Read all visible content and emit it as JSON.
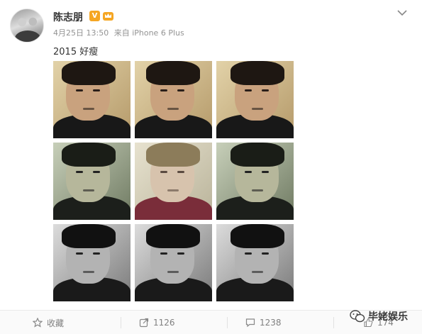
{
  "post": {
    "author": "陈志朋",
    "verified_badge": "V",
    "date": "4月25日 13:50",
    "via": "来自 iPhone 6 Plus",
    "text": "2015 好瘦"
  },
  "photos": [
    {
      "tone": "warm"
    },
    {
      "tone": "warm"
    },
    {
      "tone": "warm"
    },
    {
      "tone": "green"
    },
    {
      "tone": "faded"
    },
    {
      "tone": "green"
    },
    {
      "tone": "bw"
    },
    {
      "tone": "bw"
    },
    {
      "tone": "bw"
    }
  ],
  "actions": {
    "favorite_label": "收藏",
    "repost_count": "1126",
    "comment_count": "1238",
    "like_count": "174"
  },
  "watermark": {
    "text": "毕姥娱乐"
  },
  "colors": {
    "badge": "#f5a623",
    "action_text": "#808080"
  }
}
